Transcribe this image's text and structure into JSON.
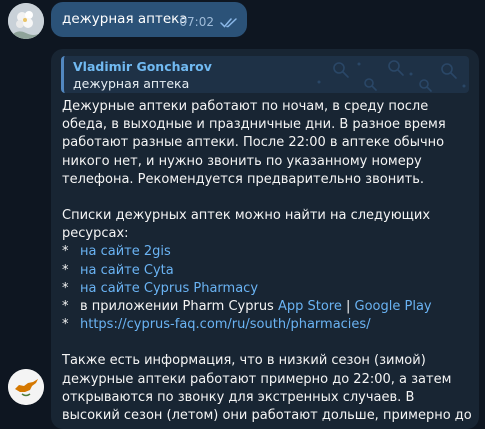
{
  "outgoing": {
    "text": "дежурная аптека",
    "time": "07:02"
  },
  "incoming": {
    "reply": {
      "author": "Vladimir Goncharov",
      "text": "дежурная аптека"
    },
    "paragraph1": "Дежурные аптеки работают по ночам, в среду после обеда, в выходные и праздничные дни. В разное время работают разные аптеки. После 22:00 в аптеке обычно никого нет, и нужно звонить по указанному номеру телефона. Рекомендуется предварительно звонить.",
    "paragraph2": "Списки дежурных аптек можно найти на следующих ресурсах:",
    "bullet": "*",
    "links": {
      "site_2gis": "на сайте 2gis",
      "site_cyta": "на сайте Cyta",
      "site_cyprus_pharmacy": "на сайте Cyprus Pharmacy",
      "app_prefix": "в приложении Pharm Cyprus ",
      "app_store": "App Store",
      "separator": " | ",
      "google_play": "Google Play",
      "faq_url": "https://cyprus-faq.com/ru/south/pharmacies/"
    },
    "paragraph3": "Также есть информация, что в низкий сезон (зимой) дежурные аптеки работают примерно до 22:00, а затем открываются по звонку для экстренных случаев. В высокий сезон (летом) они работают дольше, примерно до полуночи."
  },
  "colors": {
    "background": "#0e1621",
    "outgoing_bubble": "#2b5278",
    "incoming_bubble": "#182533",
    "link": "#6ab3f3",
    "reply_name": "#71baf2"
  }
}
